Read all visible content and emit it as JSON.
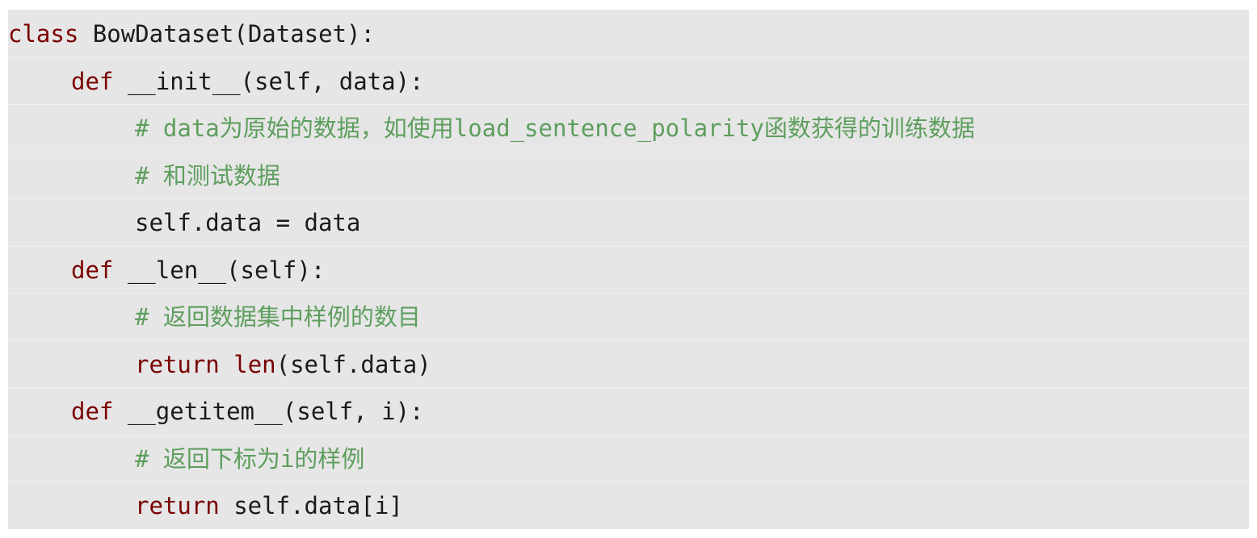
{
  "code": {
    "lines": [
      {
        "parts": [
          {
            "kw": "class"
          },
          {
            "text": " BowDataset(Dataset):"
          }
        ]
      },
      {
        "parts": [
          {
            "kw": "def"
          },
          {
            "text": " __init__(self, data):"
          }
        ]
      },
      {
        "comment": "# data为原始的数据，如使用load_sentence_polarity函数获得的训练数据"
      },
      {
        "comment": "# 和测试数据"
      },
      {
        "parts": [
          {
            "text": "self.data = data"
          }
        ]
      },
      {
        "parts": [
          {
            "kw": "def"
          },
          {
            "text": " __len__(self):"
          }
        ]
      },
      {
        "comment": "# 返回数据集中样例的数目"
      },
      {
        "parts": [
          {
            "kw": "return"
          },
          {
            "text": " "
          },
          {
            "kw2": "len"
          },
          {
            "text": "(self.data)"
          }
        ]
      },
      {
        "parts": [
          {
            "kw": "def"
          },
          {
            "text": " __getitem__(self, i):"
          }
        ]
      },
      {
        "comment": "# 返回下标为i的样例"
      },
      {
        "parts": [
          {
            "kw": "return"
          },
          {
            "text": " self.data[i]"
          }
        ]
      }
    ]
  },
  "colors": {
    "background": "#e6e6e6",
    "keyword": "#7a0000",
    "comment": "#5e9e5e",
    "text": "#1a1a1a"
  }
}
